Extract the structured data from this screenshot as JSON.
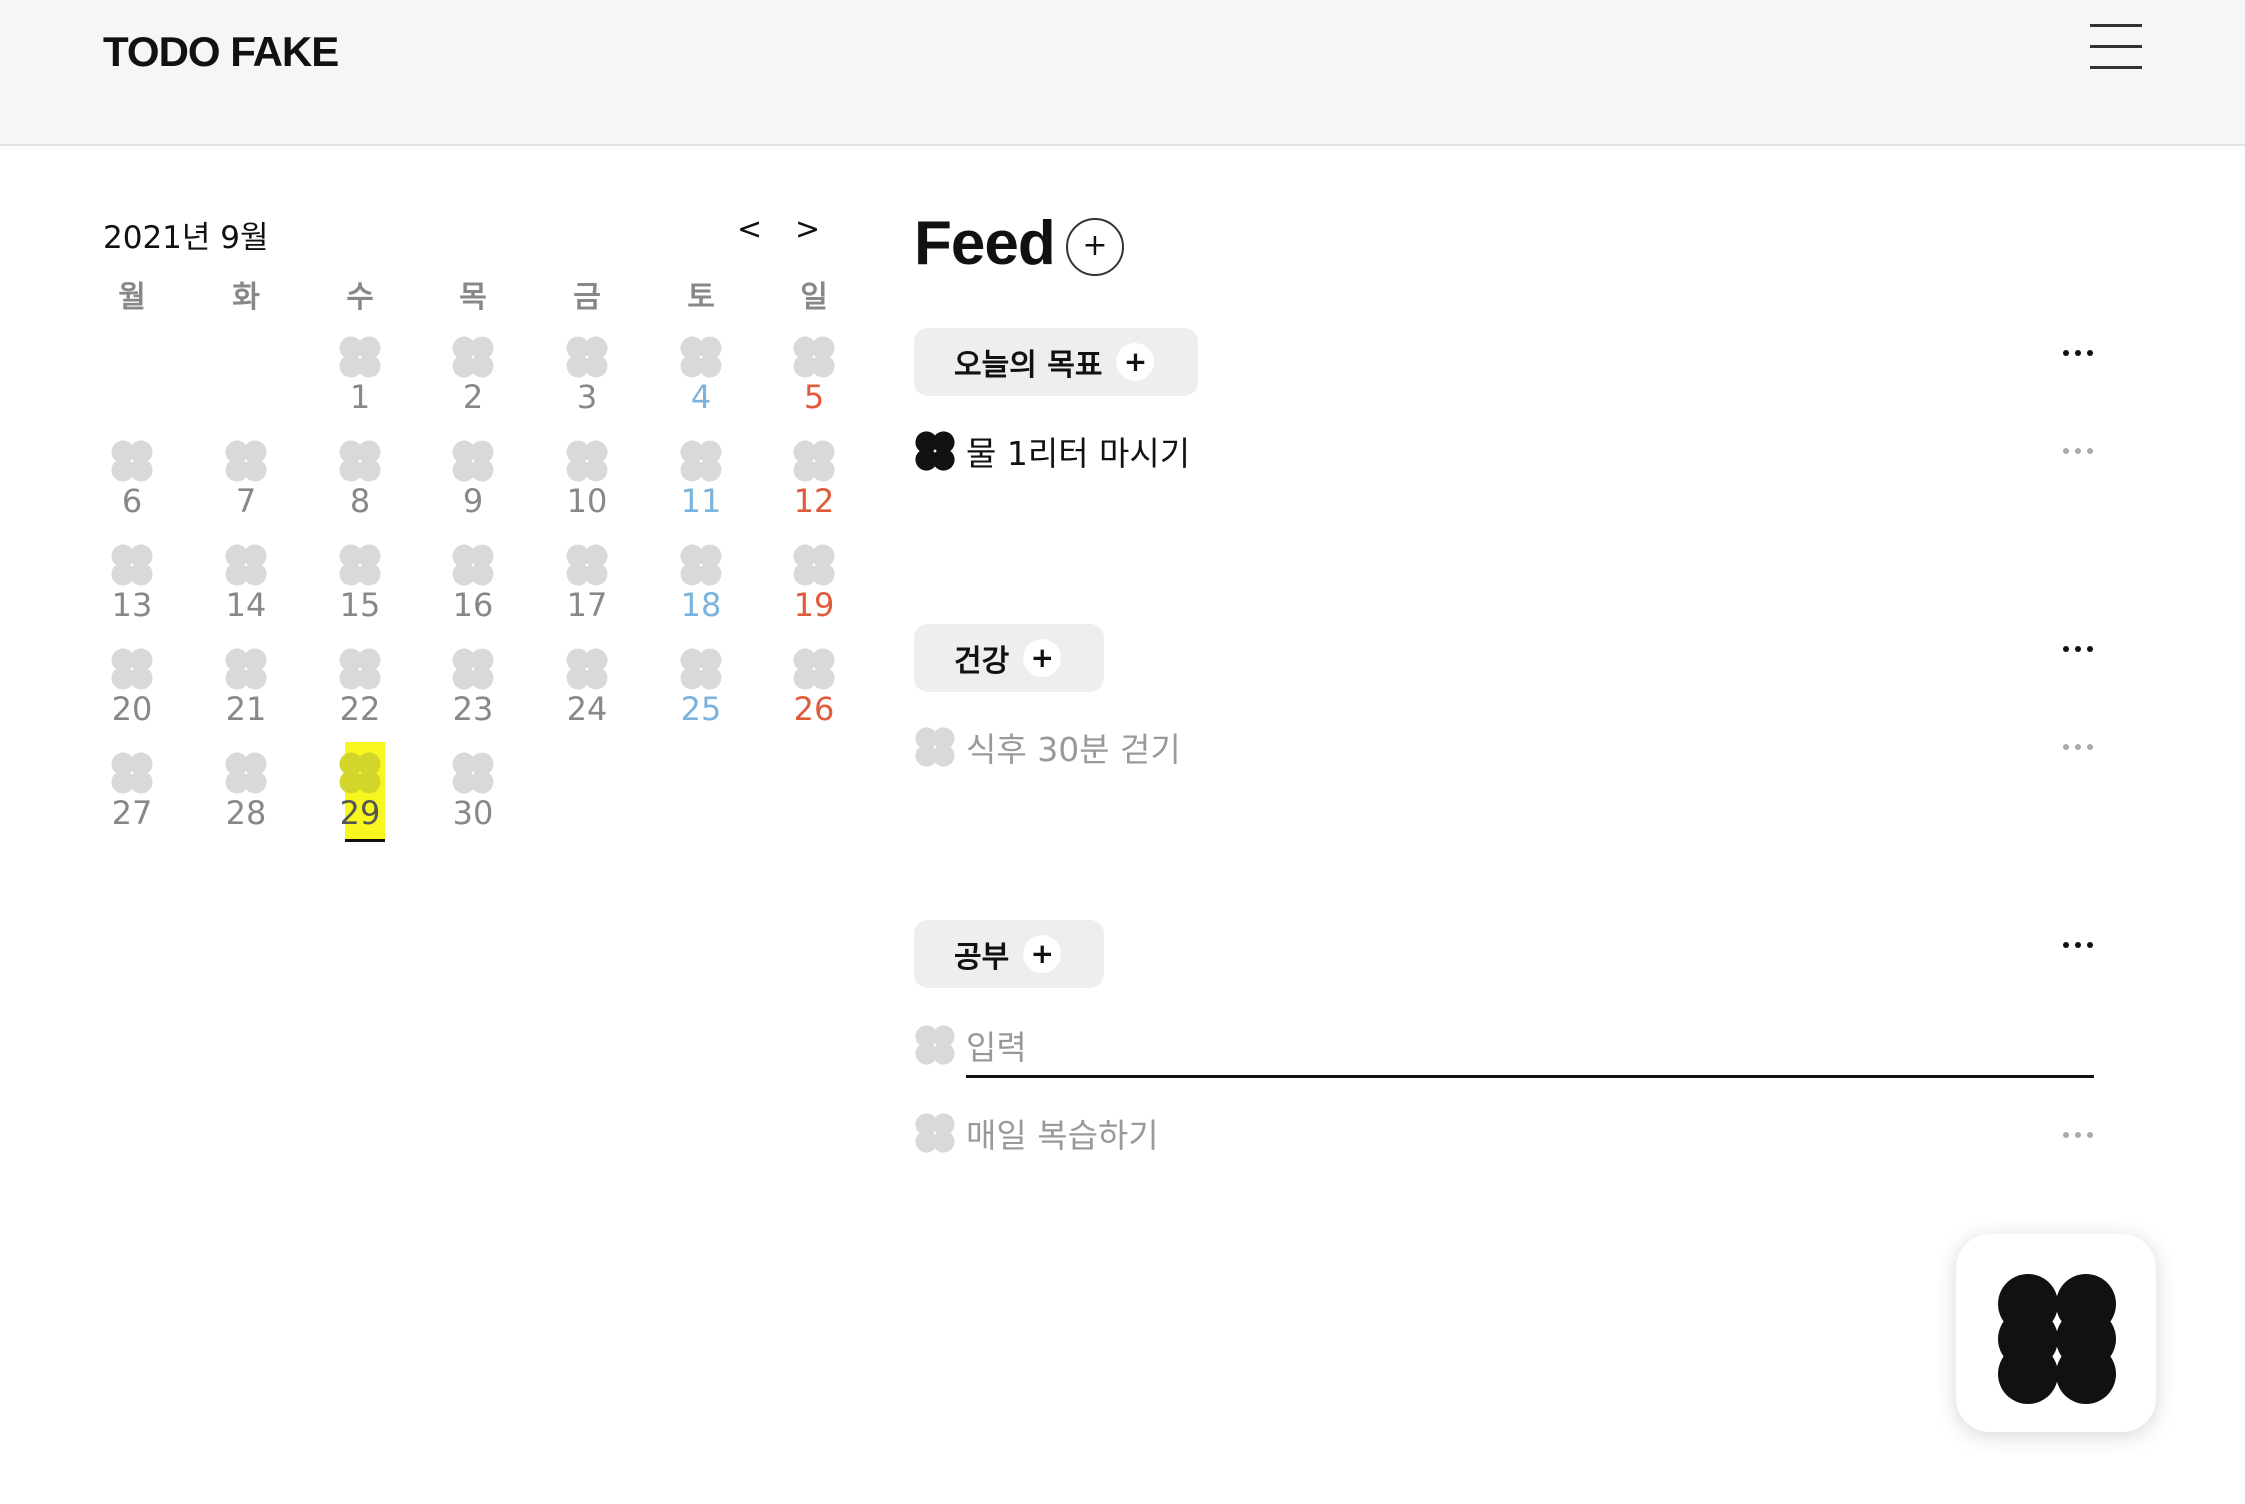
{
  "header": {
    "logo": "TODO FAKE",
    "menu_icon": "hamburger-menu-icon"
  },
  "calendar": {
    "title": "2021년 9월",
    "prev_label": "<",
    "next_label": ">",
    "weekdays": [
      "월",
      "화",
      "수",
      "목",
      "금",
      "토",
      "일"
    ],
    "weeks": [
      [
        "",
        "",
        "1",
        "2",
        "3",
        "4",
        "5"
      ],
      [
        "6",
        "7",
        "8",
        "9",
        "10",
        "11",
        "12"
      ],
      [
        "13",
        "14",
        "15",
        "16",
        "17",
        "18",
        "19"
      ],
      [
        "20",
        "21",
        "22",
        "23",
        "24",
        "25",
        "26"
      ],
      [
        "27",
        "28",
        "29",
        "30",
        "",
        "",
        ""
      ]
    ],
    "today": "29"
  },
  "feed": {
    "title": "Feed",
    "add_label": "+",
    "categories": [
      {
        "label": "오늘의 목표",
        "add_label": "+"
      },
      {
        "label": "건강",
        "add_label": "+"
      },
      {
        "label": "공부",
        "add_label": "+"
      }
    ],
    "todos": {
      "goal_1": "물 1리터 마시기",
      "health_1": "식후 30분 걷기",
      "study_1": "매일 복습하기"
    },
    "input_placeholder": "입력"
  },
  "colors": {
    "clover_done": "#111111",
    "clover_empty": "#d9d9d9",
    "saturday": "#7cb3dd",
    "sunday": "#e05a3c",
    "today_highlight": "#f7f71f"
  }
}
